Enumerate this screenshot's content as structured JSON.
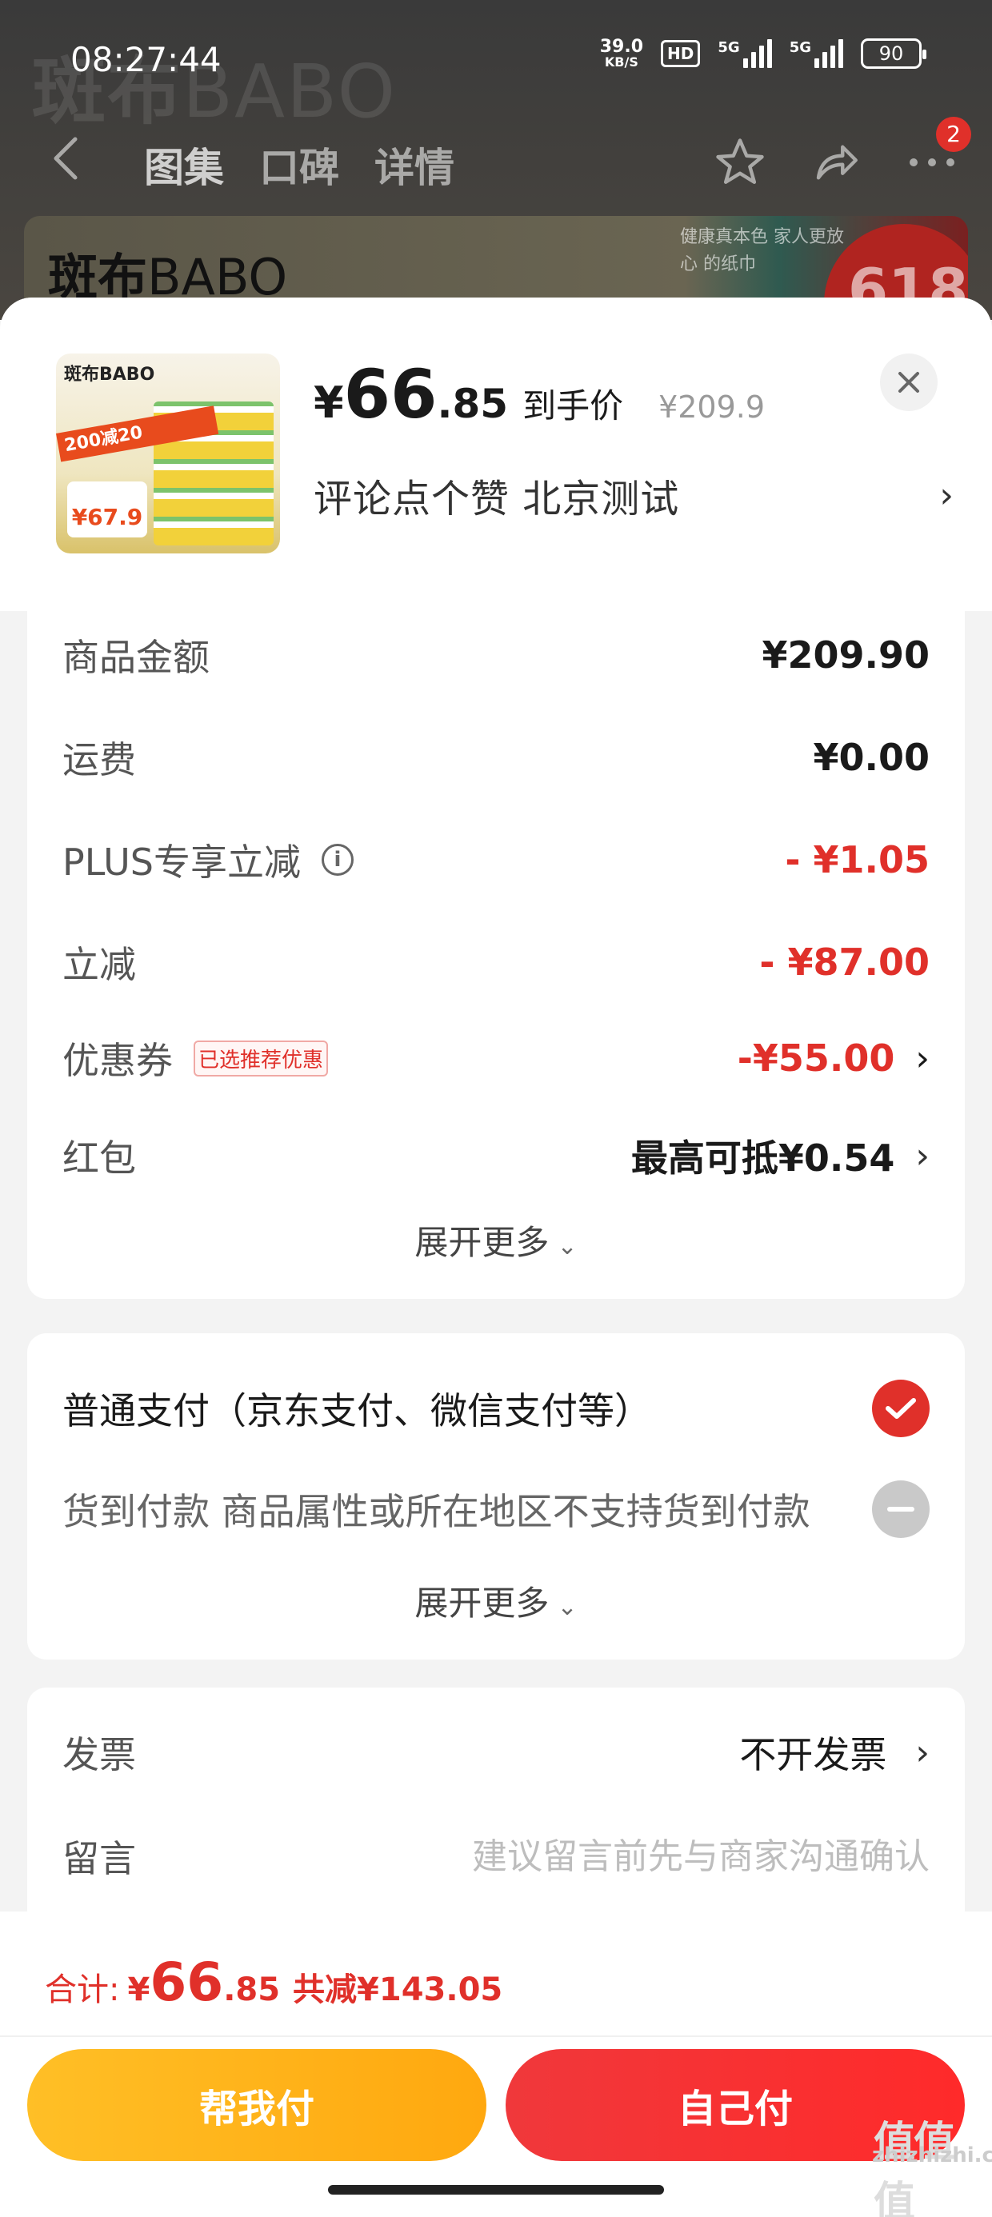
{
  "status_bar": {
    "time": "08:27:44",
    "net_speed_value": "39.0",
    "net_speed_unit": "KB/S",
    "hd_badge": "HD",
    "signal1_label": "5G",
    "signal2_label": "5G",
    "battery": "90"
  },
  "background": {
    "logo_cn": "斑布",
    "logo_latin": "BABO",
    "tabs": [
      "图集",
      "口碑",
      "详情"
    ],
    "badge_count": "2",
    "banner_logo_cn": "斑布",
    "banner_logo_latin": "BABO",
    "banner_tag": "健康真本色 家人更放心 的纸巾",
    "banner_promo": "618"
  },
  "product": {
    "thumb_brand": "斑布BABO",
    "thumb_promo": "200减20",
    "thumb_price": "¥67.9",
    "currency": "¥",
    "price_int": "66",
    "price_dec": ".85",
    "price_label": "到手价",
    "original_price": "¥209.9",
    "address": "评论点个赞  北京测试"
  },
  "amounts": {
    "rows": [
      {
        "label": "商品金额",
        "value": "¥209.90"
      },
      {
        "label": "运费",
        "value": "¥0.00"
      },
      {
        "label": "PLUS专享立减",
        "value": "- ¥1.05"
      },
      {
        "label": "立减",
        "value": "- ¥87.00"
      },
      {
        "label": "优惠券",
        "tag": "已选推荐优惠",
        "value": "-¥55.00"
      },
      {
        "label": "红包",
        "value": "最高可抵¥0.54"
      }
    ],
    "expand_label": "展开更多"
  },
  "payment": {
    "options": [
      {
        "label": "普通支付（京东支付、微信支付等）",
        "selected": true
      },
      {
        "label": "货到付款  商品属性或所在地区不支持货到付款",
        "selected": false
      }
    ],
    "expand_label": "展开更多"
  },
  "invoice": {
    "label": "发票",
    "value": "不开发票",
    "message_label": "留言",
    "message_placeholder": "建议留言前先与商家沟通确认"
  },
  "footer": {
    "total_label": "合计:",
    "currency": "¥",
    "total_int": "66",
    "total_dec": ".85",
    "saved": "共减¥143.05",
    "help_pay_label": "帮我付",
    "self_pay_label": "自己付"
  },
  "watermark": {
    "big": "值值值",
    "small": "zhizhizhi.com"
  },
  "colors": {
    "accent_red": "#e0302a",
    "help_button": "#ffb41a",
    "self_button": "#f5302f"
  }
}
